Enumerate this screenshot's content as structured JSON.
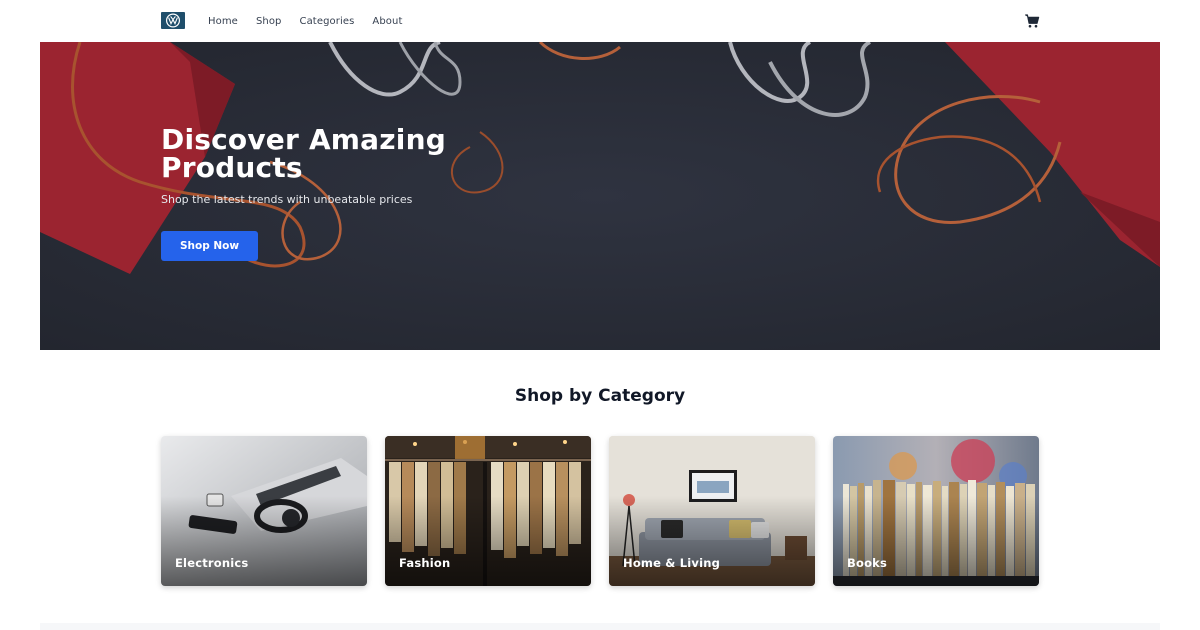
{
  "nav": {
    "logo_icon": "vw-logo-icon",
    "links": [
      "Home",
      "Shop",
      "Categories",
      "About"
    ],
    "cart_icon": "shopping-cart-icon"
  },
  "hero": {
    "title": "Discover Amazing Products",
    "subtitle": "Shop the latest trends with unbeatable prices",
    "button_label": "Shop Now"
  },
  "categories": {
    "heading": "Shop by Category",
    "items": [
      {
        "label": "Electronics"
      },
      {
        "label": "Fashion"
      },
      {
        "label": "Home & Living"
      },
      {
        "label": "Books"
      }
    ]
  },
  "colors": {
    "accent": "#2563eb",
    "hero_bg": "#2c2f3b",
    "bag_red": "#9b2430"
  }
}
